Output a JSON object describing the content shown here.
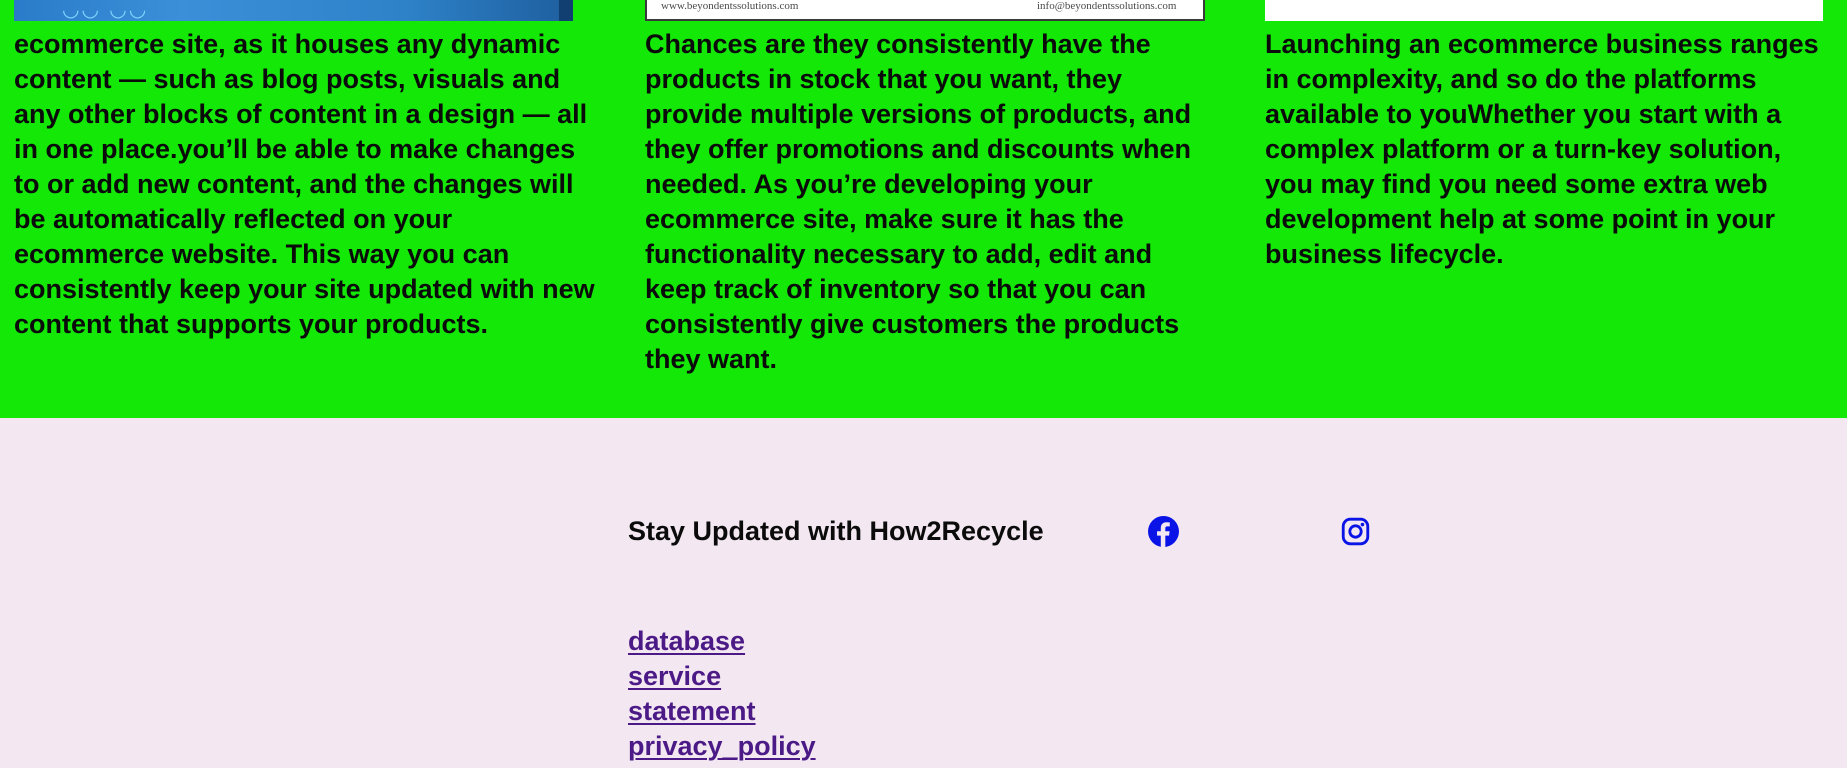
{
  "columns": [
    {
      "image": "blue-banner-image",
      "text": "ecommerce site, as it houses any dynamic content — such as blog posts, visuals and any other blocks of content in a design — all in one place.you’ll be able to make changes to or add new content, and the changes will be automatically reflected on your ecommerce website. This way you can consistently keep your site updated with new content that supports your products."
    },
    {
      "image": "business-card-image",
      "image_text_left": "www.beyondentssolutions.com",
      "image_text_right": "info@beyondentssolutions.com",
      "text": "Chances are they consistently have the products in stock that you want, they provide multiple versions of products, and they offer promotions and discounts when needed. As you’re developing your ecommerce site, make sure it has the functionality necessary to add, edit and keep track of inventory so that you can consistently give customers the products they want."
    },
    {
      "image": "white-image",
      "text": "Launching an ecommerce business ranges in complexity, and so do the platforms available to youWhether you start with a complex platform or a turn-key solution, you may find you need some extra web development help at some point in your business lifecycle."
    }
  ],
  "footer": {
    "stay_updated": "Stay Updated with How2Recycle",
    "social_icons": [
      "facebook-icon",
      "instagram-icon"
    ],
    "links": [
      "database",
      "service",
      "statement",
      "privacy_policy"
    ]
  },
  "colors": {
    "green_band": "#13e806",
    "footer_bg": "#f3e8f1",
    "link": "#4b1a86",
    "icon": "#0a14e6"
  }
}
